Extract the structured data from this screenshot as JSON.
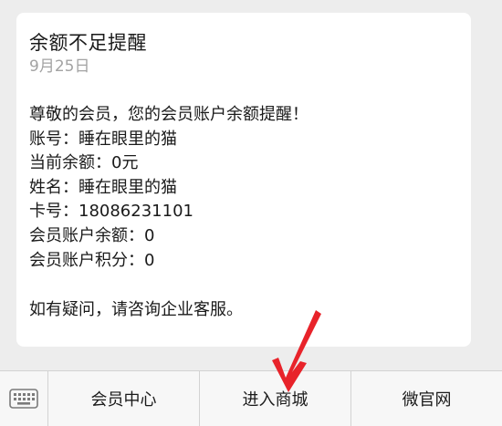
{
  "message": {
    "title": "余额不足提醒",
    "date": "9月25日",
    "lines": [
      "尊敬的会员，您的会员账户余额提醒！",
      "账号：睡在眼里的猫",
      "当前余额：0元",
      "姓名：睡在眼里的猫",
      "卡号：18086231101",
      "会员账户余额：0",
      "会员账户积分：0"
    ],
    "footer": "如有疑问，请咨询企业客服。"
  },
  "menu": {
    "keyboard_icon": "keyboard-icon",
    "items": [
      {
        "label": "会员中心"
      },
      {
        "label": "进入商城"
      },
      {
        "label": "微官网"
      }
    ]
  },
  "annotation": {
    "arrow_color": "#e8232a"
  }
}
